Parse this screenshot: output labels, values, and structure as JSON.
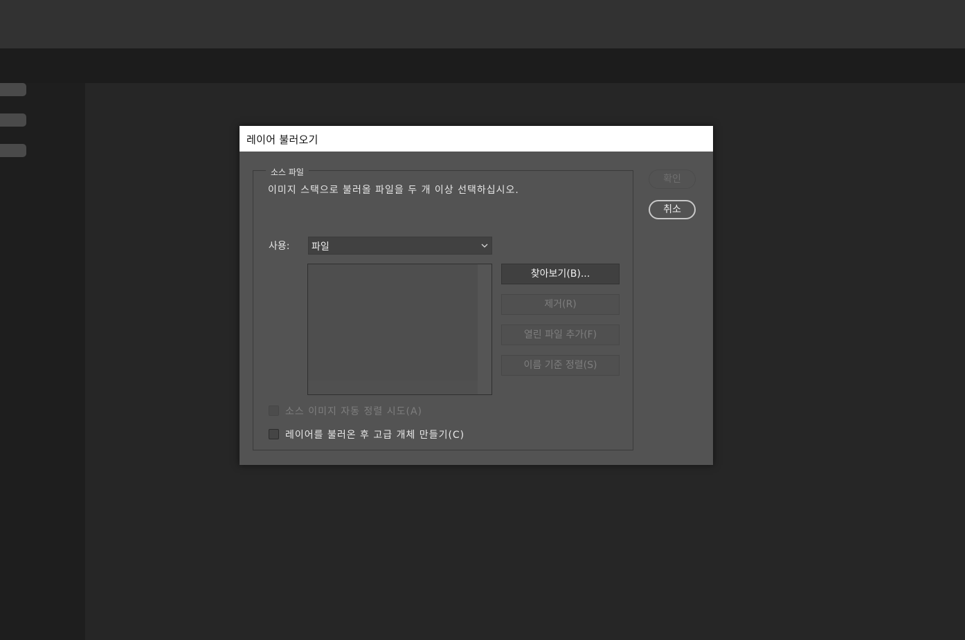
{
  "dialog": {
    "title": "레이어 불러오기",
    "group_label": "소스 파일",
    "description": "이미지 스택으로 불러올 파일을 두 개 이상 선택하십시오.",
    "use_label": "사용:",
    "use_value": "파일",
    "buttons": {
      "browse": "찾아보기(B)...",
      "remove": "제거(R)",
      "add_open_files": "열린 파일 추가(F)",
      "sort_by_name": "이름 기준 정렬(S)"
    },
    "checkboxes": {
      "auto_align": "소스 이미지 자동 정렬 시도(A)",
      "smart_object": "레이어를 불러온 후 고급 개체 만들기(C)"
    },
    "ok": "확인",
    "cancel": "취소"
  }
}
